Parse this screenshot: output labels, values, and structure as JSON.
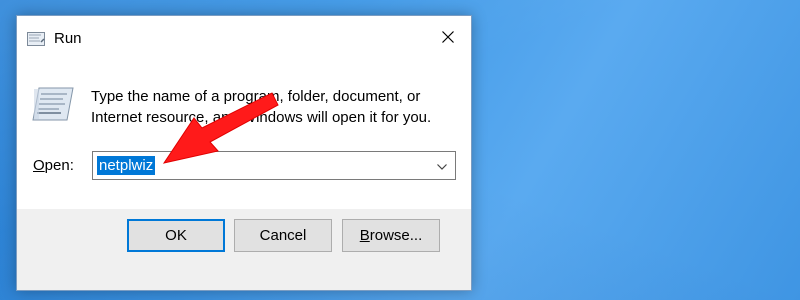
{
  "window": {
    "title": "Run",
    "close_icon": "close-icon",
    "title_icon": "run-icon"
  },
  "content": {
    "icon": "run-icon",
    "description_line1": "Type the name of a program, folder, document, or",
    "description_line2": "Internet resource, and Windows will open it for you.",
    "open_label_accel": "O",
    "open_label_rest": "pen:",
    "input_value": "netplwiz",
    "dropdown_icon": "chevron-down-icon"
  },
  "buttons": {
    "ok": "OK",
    "cancel": "Cancel",
    "browse_accel": "B",
    "browse_rest": "rowse..."
  },
  "colors": {
    "selection": "#0078d7",
    "default_button_border": "#0078d7",
    "footer_background": "#f0f0f0",
    "desktop": "#3d97e6",
    "annotation_arrow": "#ff0000"
  },
  "annotation": {
    "type": "red-arrow",
    "points_to": "input_value"
  }
}
